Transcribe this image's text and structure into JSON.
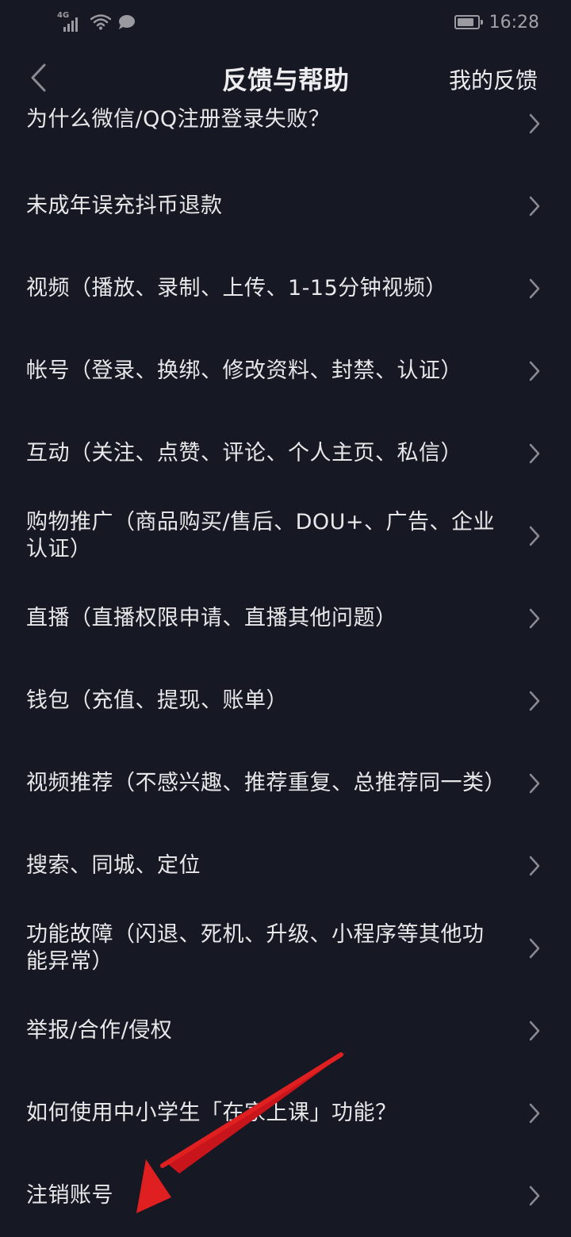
{
  "status_bar": {
    "network": "4G",
    "time": "16:28",
    "battery_level": 0.85
  },
  "nav": {
    "title": "反馈与帮助",
    "right_action": "我的反馈"
  },
  "items": [
    {
      "label": "为什么微信/QQ注册登录失败？"
    },
    {
      "label": "未成年误充抖币退款"
    },
    {
      "label": "视频（播放、录制、上传、1-15分钟视频）"
    },
    {
      "label": "帐号（登录、换绑、修改资料、封禁、认证）"
    },
    {
      "label": "互动（关注、点赞、评论、个人主页、私信）"
    },
    {
      "label": "购物推广（商品购买/售后、DOU+、广告、企业认证）"
    },
    {
      "label": "直播（直播权限申请、直播其他问题）"
    },
    {
      "label": "钱包（充值、提现、账单）"
    },
    {
      "label": "视频推荐（不感兴趣、推荐重复、总推荐同一类）"
    },
    {
      "label": "搜索、同城、定位"
    },
    {
      "label": "功能故障（闪退、死机、升级、小程序等其他功能异常）"
    },
    {
      "label": "举报/合作/侵权"
    },
    {
      "label": "如何使用中小学生「在家上课」功能？"
    },
    {
      "label": "注销账号"
    }
  ],
  "colors": {
    "background": "#161823",
    "text": "#e8e8ea",
    "chevron": "#8a8b93",
    "annotation": "#e02020"
  }
}
